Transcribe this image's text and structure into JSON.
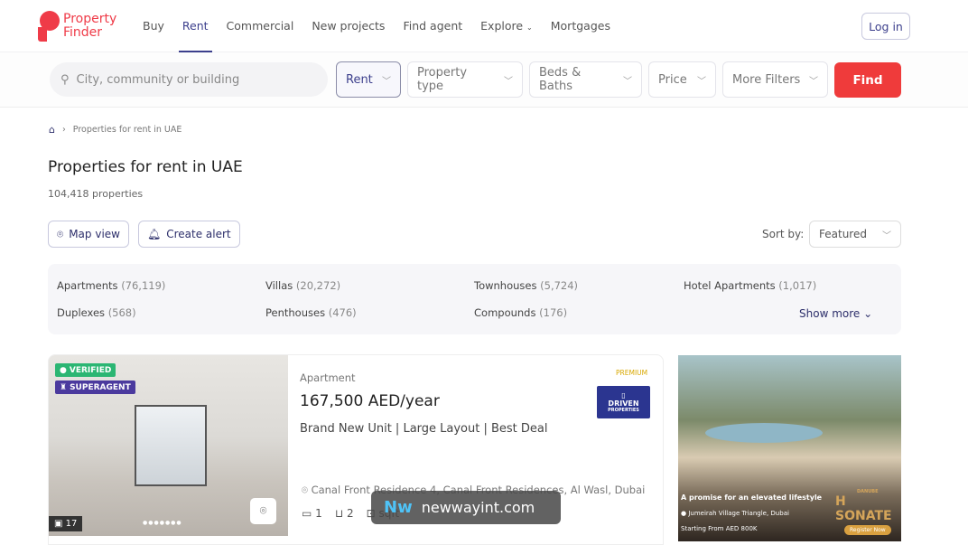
{
  "header": {
    "logo_text": "Property Finder",
    "nav": [
      "Buy",
      "Rent",
      "Commercial",
      "New projects",
      "Find agent",
      "Explore",
      "Mortgages"
    ],
    "active": "Rent",
    "login": "Log in"
  },
  "search": {
    "placeholder": "City, community or building",
    "purpose": "Rent",
    "property_type": "Property type",
    "beds_baths": "Beds & Baths",
    "price": "Price",
    "more_filters": "More Filters",
    "find": "Find"
  },
  "breadcrumb": {
    "current": "Properties for rent in UAE"
  },
  "page": {
    "title": "Properties for rent in UAE",
    "count": "104,418 properties",
    "map_view": "Map view",
    "create_alert": "Create alert",
    "sort_label": "Sort by:",
    "sort_value": "Featured"
  },
  "types": [
    {
      "name": "Apartments",
      "count": "(76,119)"
    },
    {
      "name": "Villas",
      "count": "(20,272)"
    },
    {
      "name": "Townhouses",
      "count": "(5,724)"
    },
    {
      "name": "Hotel Apartments",
      "count": "(1,017)"
    },
    {
      "name": "Duplexes",
      "count": "(568)"
    },
    {
      "name": "Penthouses",
      "count": "(476)"
    },
    {
      "name": "Compounds",
      "count": "(176)"
    }
  ],
  "show_more": "Show more",
  "listing": {
    "verified": "VERIFIED",
    "superagent": "SUPERAGENT",
    "photos": "17",
    "type": "Apartment",
    "price": "167,500 AED/year",
    "title": "Brand New Unit | Large Layout | Best Deal",
    "premium": "PREMIUM",
    "agency": "DRIVEN",
    "agency_sub": "PROPERTIES",
    "location": "Canal Front Residence 4, Canal Front Residences, Al Wasl, Dubai",
    "beds": "1",
    "baths": "2",
    "area": "sqft"
  },
  "ad": {
    "headline": "A promise for an elevated lifestyle",
    "location": "Jumeirah Village Triangle, Dubai",
    "price": "Starting From AED 800K",
    "brand": "SONATE",
    "brand_top": "DANUBE",
    "cta": "Register Now"
  },
  "watermark": {
    "mark": "Nw",
    "text": "newwayint.com"
  },
  "colors": {
    "brand": "#ef3b48",
    "accent": "#3c3f8c",
    "find": "#ef3b3b"
  }
}
